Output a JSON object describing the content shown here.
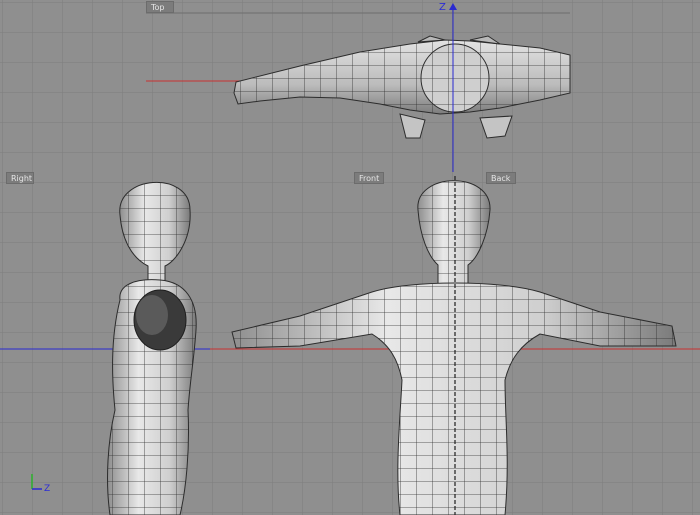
{
  "viewports": {
    "top": {
      "label": "Top"
    },
    "right": {
      "label": "Right"
    },
    "front": {
      "label": "Front"
    },
    "back": {
      "label": "Back"
    }
  },
  "axis": {
    "z_label": "Z"
  },
  "gizmo": {
    "z_label": "Z"
  },
  "colors": {
    "background": "#8f8f8f",
    "grid": "#7f7f7f",
    "axis_red": "#c83030",
    "axis_blue": "#2a2ad0",
    "mesh_fill": "#c9c9c9",
    "mesh_line": "#2c2c2c"
  }
}
